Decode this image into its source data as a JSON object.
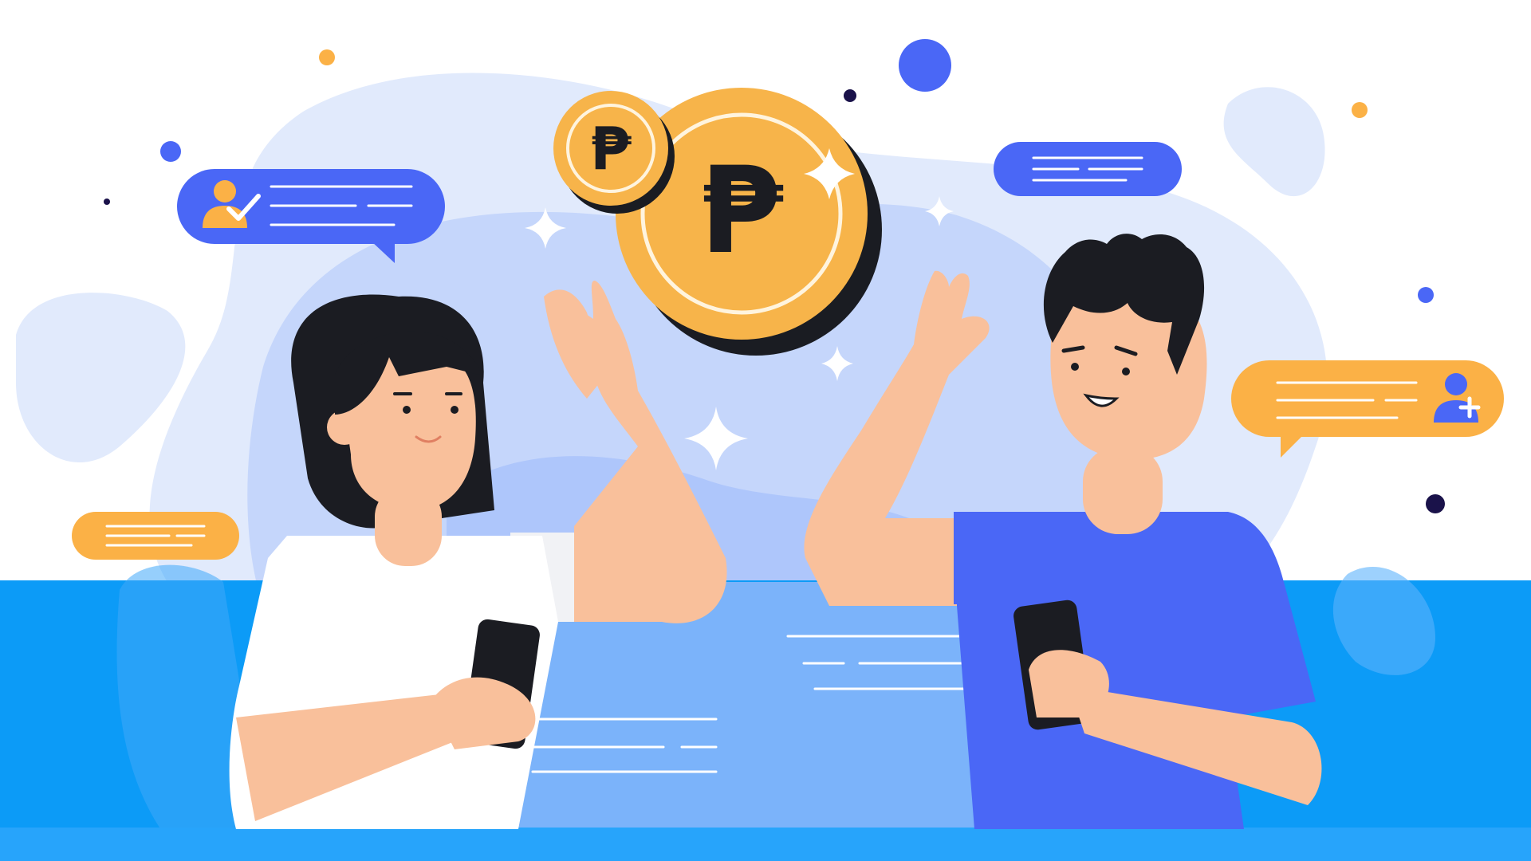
{
  "colors": {
    "background": "#ffffff",
    "blob_light": "#e1eafc",
    "blob_mid": "#c5d6fb",
    "band_blue": "#0c9bf7",
    "band_bottom": "#27a4fb",
    "screen_panel": "#7bb3fa",
    "accent_blue": "#4a67f6",
    "accent_orange": "#fbb146",
    "coin_gold": "#f7b44a",
    "coin_shadow": "#1a1c22",
    "skin": "#f9c09b",
    "hair": "#1b1c22",
    "white_shirt": "#ffffff",
    "blue_shirt": "#4a67f6",
    "dot_navy": "#1a124a"
  },
  "coins": [
    {
      "symbol": "₱",
      "name": "large-peso-coin-icon"
    },
    {
      "symbol": "₱",
      "name": "small-peso-coin-icon"
    }
  ],
  "bubbles": [
    {
      "name": "user-verified-bubble",
      "color": "blue",
      "icon": "user-check-icon"
    },
    {
      "name": "text-bubble-top-right",
      "color": "blue",
      "icon": "none"
    },
    {
      "name": "user-add-bubble",
      "color": "orange",
      "icon": "user-add-icon"
    },
    {
      "name": "text-bubble-left",
      "color": "orange",
      "icon": "none"
    }
  ],
  "characters": [
    {
      "name": "woman-character",
      "shirt": "white",
      "holding": "smartphone"
    },
    {
      "name": "man-character",
      "shirt": "blue",
      "holding": "smartphone"
    }
  ]
}
